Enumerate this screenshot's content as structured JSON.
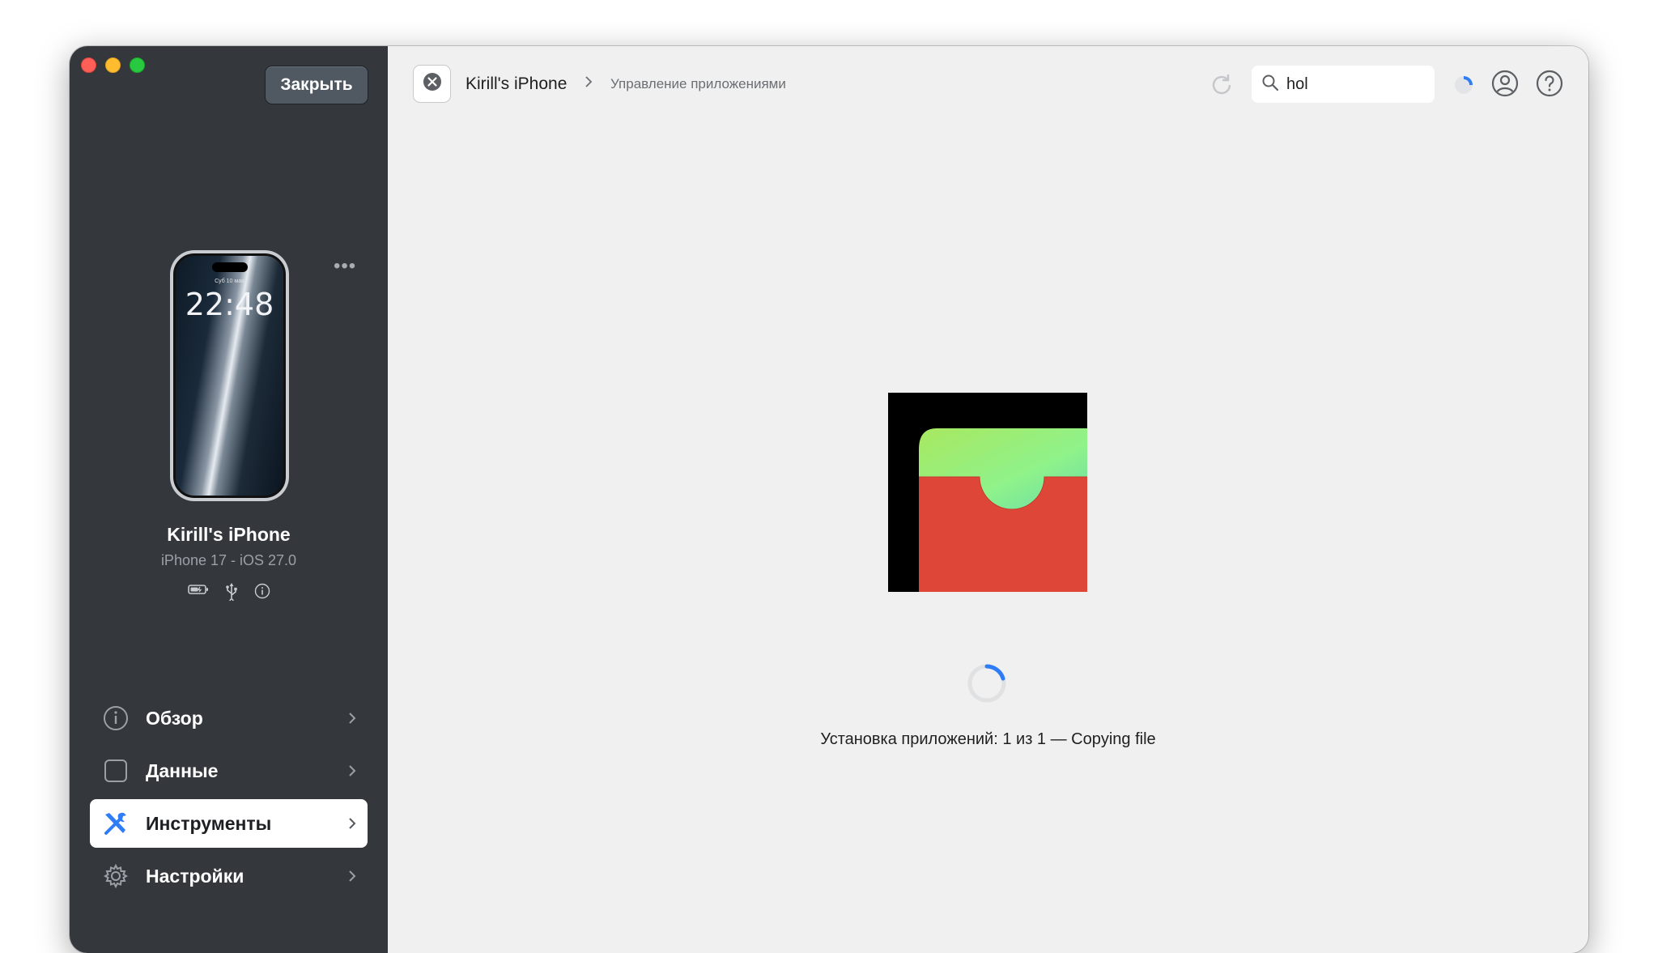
{
  "window": {
    "controls": [
      "close",
      "minimize",
      "zoom"
    ]
  },
  "sidebar": {
    "close_button": "Закрыть",
    "more_menu": "•••",
    "device": {
      "lock_time": "22:48",
      "lock_date": "Суб 10 мая",
      "name": "Kirill's iPhone",
      "subtitle": "iPhone 17 - iOS 27.0",
      "status_icons": [
        "battery-icon",
        "usb-icon",
        "info-icon"
      ]
    },
    "nav": [
      {
        "label": "Обзор",
        "icon": "info-icon",
        "active": false
      },
      {
        "label": "Данные",
        "icon": "square-icon",
        "active": false
      },
      {
        "label": "Инструменты",
        "icon": "tools-icon",
        "active": true
      },
      {
        "label": "Настройки",
        "icon": "gear-icon",
        "active": false
      }
    ]
  },
  "toolbar": {
    "breadcrumb_device": "Kirill's iPhone",
    "breadcrumb_page": "Управление приложениями",
    "search_value": "hol",
    "icons": [
      "close-circle-icon",
      "refresh-icon",
      "search-icon",
      "progress-pie-icon",
      "account-icon",
      "help-icon"
    ]
  },
  "main": {
    "install_status": "Установка приложений: 1 из 1 — Copying file"
  },
  "colors": {
    "sidebar_bg": "#34383d",
    "main_bg": "#f0f0f0",
    "accent": "#2f7df6",
    "wallet_red": "#de4637",
    "wallet_green": "#8ff28a"
  }
}
